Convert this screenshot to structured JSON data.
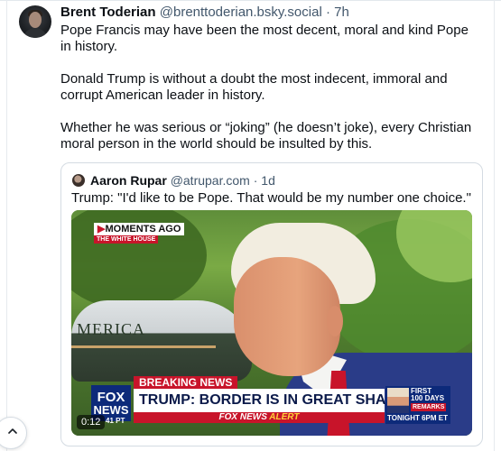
{
  "post": {
    "author_name": "Brent Toderian",
    "author_handle": "@brenttoderian.bsky.social",
    "separator": "·",
    "time": "7h",
    "paragraphs": [
      "Pope Francis may have been the most decent, moral and kind Pope in history.",
      "Donald Trump is without a doubt the most indecent, immoral and corrupt American leader in history.",
      "Whether he was serious or “joking” (he doesn’t joke), every Christian moral person in the world should be insulted by this."
    ]
  },
  "quote": {
    "author_name": "Aaron Rupar",
    "author_handle": "@atrupar.com",
    "separator": "·",
    "time": "1d",
    "text": "Trump: \"I'd like to be Pope. That would be my number one choice.\""
  },
  "video": {
    "moments_arrow": "▶",
    "moments_label": "MOMENTS AGO",
    "location_label": "THE WHITE HOUSE",
    "helicopter_text": "MERICA",
    "breaking_news": "BREAKING NEWS",
    "headline": "TRUMP: BORDER IS IN GREAT SHAPE",
    "alert_brand": "FOX NEWS",
    "alert_word": "ALERT",
    "network_logo_line1": "FOX",
    "network_logo_line2": "NEWS",
    "promo_first": "FIRST",
    "promo_days": "100 DAYS",
    "promo_remarks": "REMARKS",
    "promo_time": "TONIGHT 6PM ET",
    "clock": "41 PT",
    "timestamp": "0:12"
  },
  "icons": {
    "scroll_top": "chevron-up-icon"
  },
  "colors": {
    "handle_gray": "#42576c",
    "fox_red": "#c8142a",
    "fox_blue": "#0d2a7a"
  }
}
